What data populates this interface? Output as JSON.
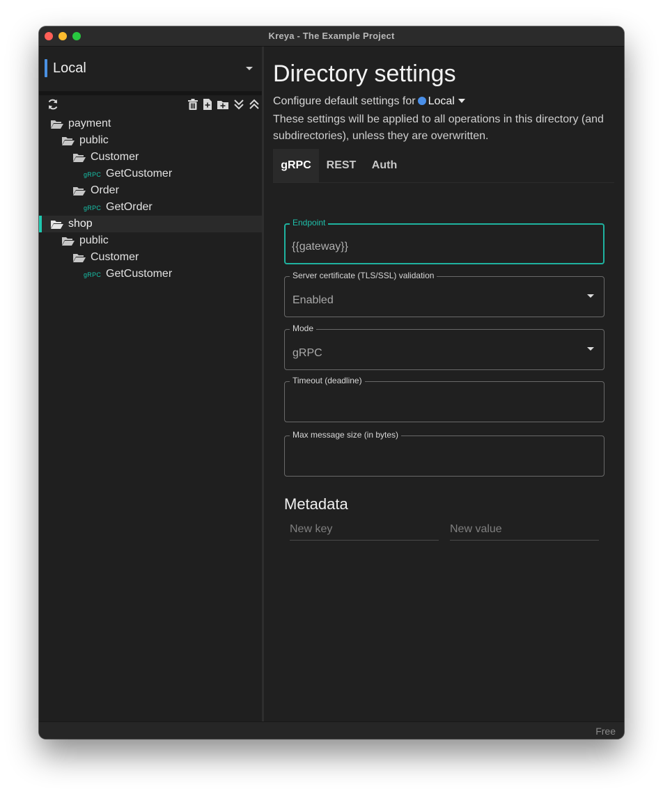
{
  "window": {
    "title": "Kreya - The Example Project"
  },
  "sidebar": {
    "environment": "Local",
    "tree": [
      {
        "label": "payment",
        "kind": "folder"
      },
      {
        "label": "public",
        "kind": "folder"
      },
      {
        "label": "Customer",
        "kind": "folder"
      },
      {
        "label": "GetCustomer",
        "kind": "operation",
        "method": "gRPC"
      },
      {
        "label": "Order",
        "kind": "folder"
      },
      {
        "label": "GetOrder",
        "kind": "operation",
        "method": "gRPC"
      },
      {
        "label": "shop",
        "kind": "folder",
        "selected": true
      },
      {
        "label": "public",
        "kind": "folder"
      },
      {
        "label": "Customer",
        "kind": "folder"
      },
      {
        "label": "GetCustomer",
        "kind": "operation",
        "method": "gRPC"
      }
    ],
    "toolbar_icons": [
      "refresh-icon",
      "delete-icon",
      "new-file-icon",
      "new-folder-icon",
      "expand-all-icon",
      "collapse-all-icon"
    ]
  },
  "main": {
    "title": "Directory settings",
    "configure_prefix": "Configure default settings for",
    "configure_env": "Local",
    "description": "These settings will be applied to all operations in this directory (and subdirectories), unless they are overwritten.",
    "tabs": [
      {
        "label": "gRPC",
        "active": true
      },
      {
        "label": "REST"
      },
      {
        "label": "Auth"
      }
    ],
    "fields": {
      "endpoint": {
        "label": "Endpoint",
        "value": "{{gateway}}"
      },
      "tls": {
        "label": "Server certificate (TLS/SSL) validation",
        "value": "Enabled"
      },
      "mode": {
        "label": "Mode",
        "value": "gRPC"
      },
      "timeout": {
        "label": "Timeout (deadline)",
        "value": ""
      },
      "max_message": {
        "label": "Max message size (in bytes)",
        "value": ""
      }
    },
    "metadata": {
      "title": "Metadata",
      "key_placeholder": "New key",
      "value_placeholder": "New value"
    }
  },
  "statusbar": {
    "plan": "Free"
  },
  "colors": {
    "accent_teal": "#1fb3a0",
    "environment_blue": "#4a8fe8",
    "background": "#202020"
  }
}
